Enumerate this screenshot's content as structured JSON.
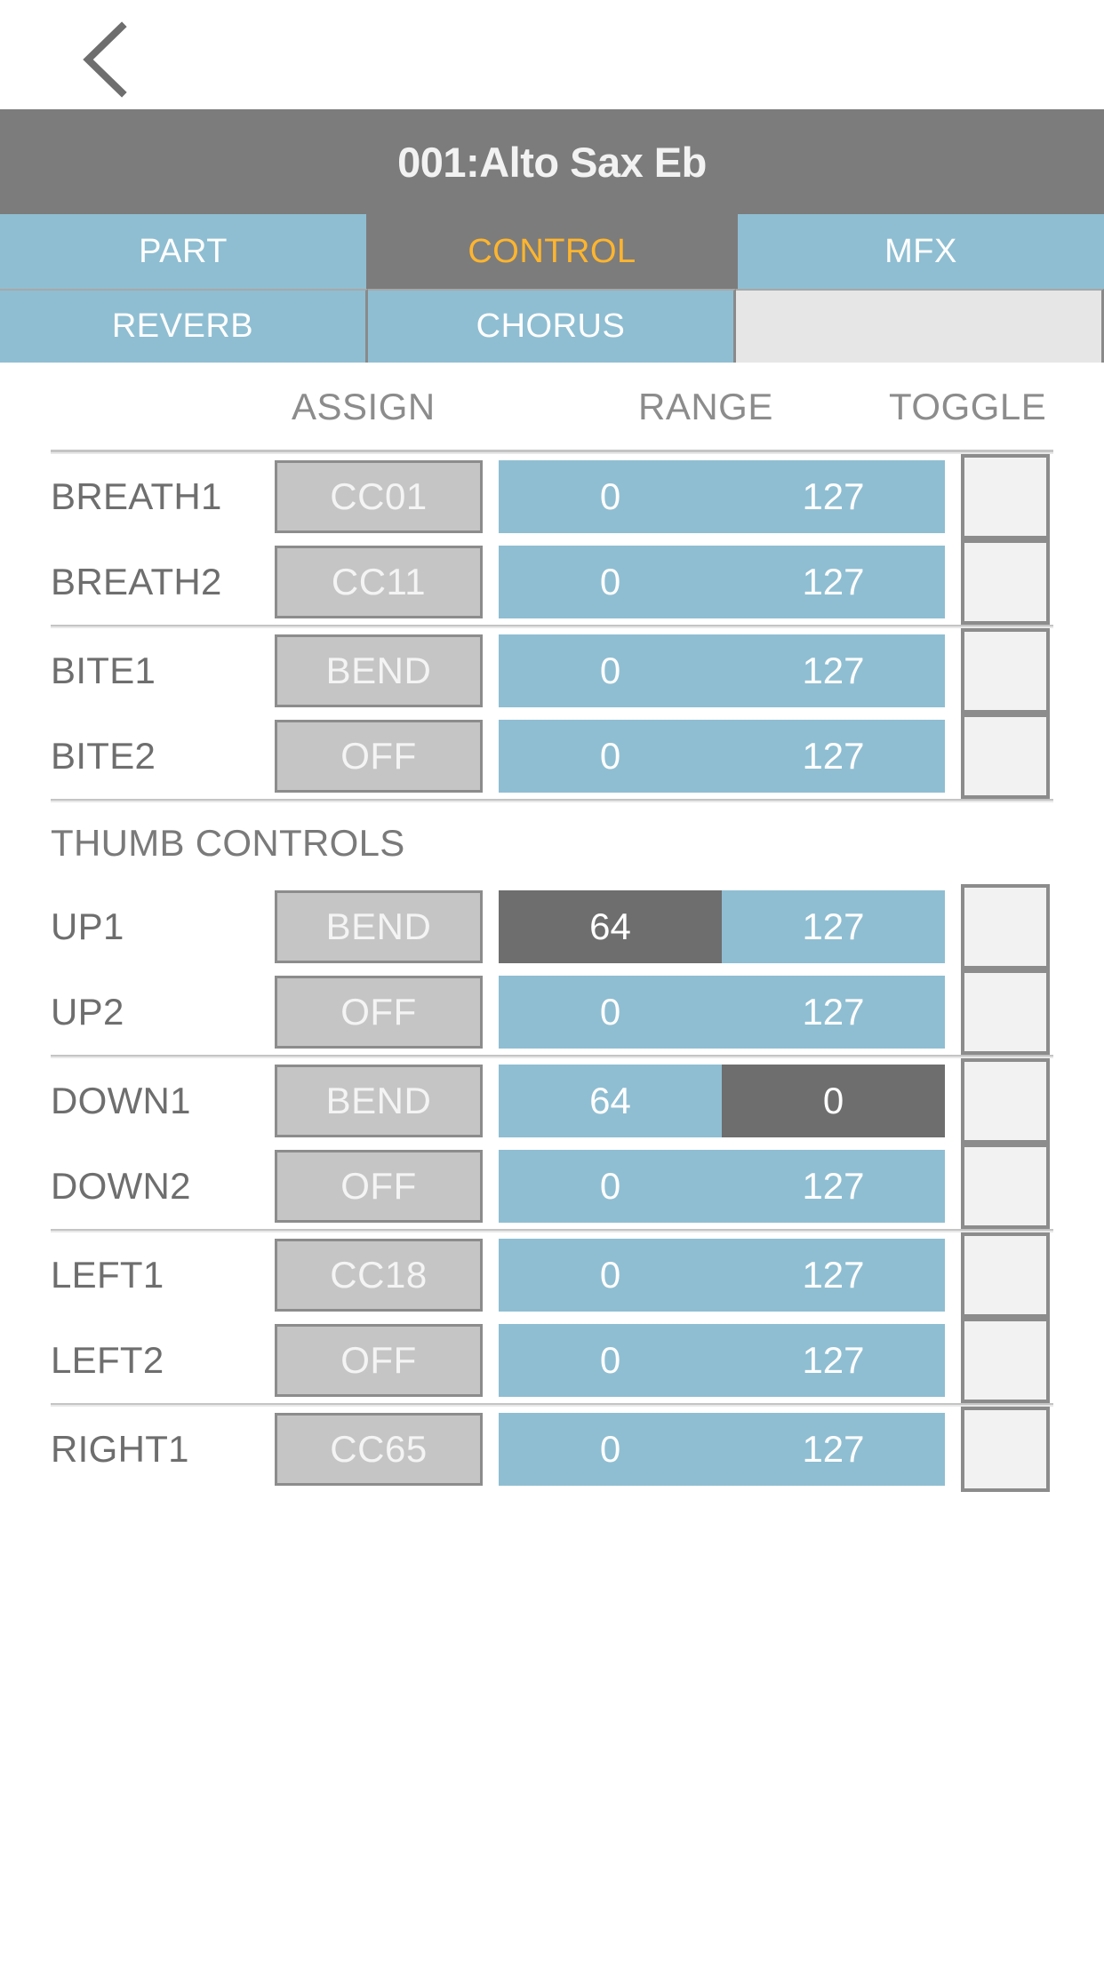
{
  "navbar": {
    "back_icon": "chevron-left-icon"
  },
  "title": {
    "text": "001:Alto Sax Eb"
  },
  "tabs_primary": [
    {
      "label": "PART",
      "active": false
    },
    {
      "label": "CONTROL",
      "active": true
    },
    {
      "label": "MFX",
      "active": false
    }
  ],
  "tabs_secondary": [
    {
      "label": "REVERB",
      "active": false
    },
    {
      "label": "CHORUS",
      "active": false
    },
    {
      "label": "",
      "active": false
    }
  ],
  "column_headers": {
    "assign": "ASSIGN",
    "range": "RANGE",
    "toggle": "TOGGLE"
  },
  "sections": [
    {
      "label": null,
      "rows": [
        {
          "name": "BREATH1",
          "assign": "CC01",
          "range_low": "0",
          "range_high": "127",
          "low_dark": false,
          "high_dark": false,
          "toggle": false
        },
        {
          "name": "BREATH2",
          "assign": "CC11",
          "range_low": "0",
          "range_high": "127",
          "low_dark": false,
          "high_dark": false,
          "toggle": false
        }
      ]
    },
    {
      "label": null,
      "rows": [
        {
          "name": "BITE1",
          "assign": "BEND",
          "range_low": "0",
          "range_high": "127",
          "low_dark": false,
          "high_dark": false,
          "toggle": false
        },
        {
          "name": "BITE2",
          "assign": "OFF",
          "range_low": "0",
          "range_high": "127",
          "low_dark": false,
          "high_dark": false,
          "toggle": false
        }
      ]
    },
    {
      "label": "THUMB CONTROLS",
      "rows": [
        {
          "name": "UP1",
          "assign": "BEND",
          "range_low": "64",
          "range_high": "127",
          "low_dark": true,
          "high_dark": false,
          "toggle": false
        },
        {
          "name": "UP2",
          "assign": "OFF",
          "range_low": "0",
          "range_high": "127",
          "low_dark": false,
          "high_dark": false,
          "toggle": false
        }
      ]
    },
    {
      "label": null,
      "rows": [
        {
          "name": "DOWN1",
          "assign": "BEND",
          "range_low": "64",
          "range_high": "0",
          "low_dark": false,
          "high_dark": true,
          "toggle": false
        },
        {
          "name": "DOWN2",
          "assign": "OFF",
          "range_low": "0",
          "range_high": "127",
          "low_dark": false,
          "high_dark": false,
          "toggle": false
        }
      ]
    },
    {
      "label": null,
      "rows": [
        {
          "name": "LEFT1",
          "assign": "CC18",
          "range_low": "0",
          "range_high": "127",
          "low_dark": false,
          "high_dark": false,
          "toggle": false
        },
        {
          "name": "LEFT2",
          "assign": "OFF",
          "range_low": "0",
          "range_high": "127",
          "low_dark": false,
          "high_dark": false,
          "toggle": false
        }
      ]
    },
    {
      "label": null,
      "rows": [
        {
          "name": "RIGHT1",
          "assign": "CC65",
          "range_low": "0",
          "range_high": "127",
          "low_dark": false,
          "high_dark": false,
          "toggle": false
        }
      ]
    }
  ],
  "colors": {
    "accent_blue": "#8fbed2",
    "header_gray": "#7c7c7c",
    "active_orange": "#ffb52e",
    "assign_gray": "#c5c5c5",
    "dark_segment": "#6e6e6e"
  }
}
